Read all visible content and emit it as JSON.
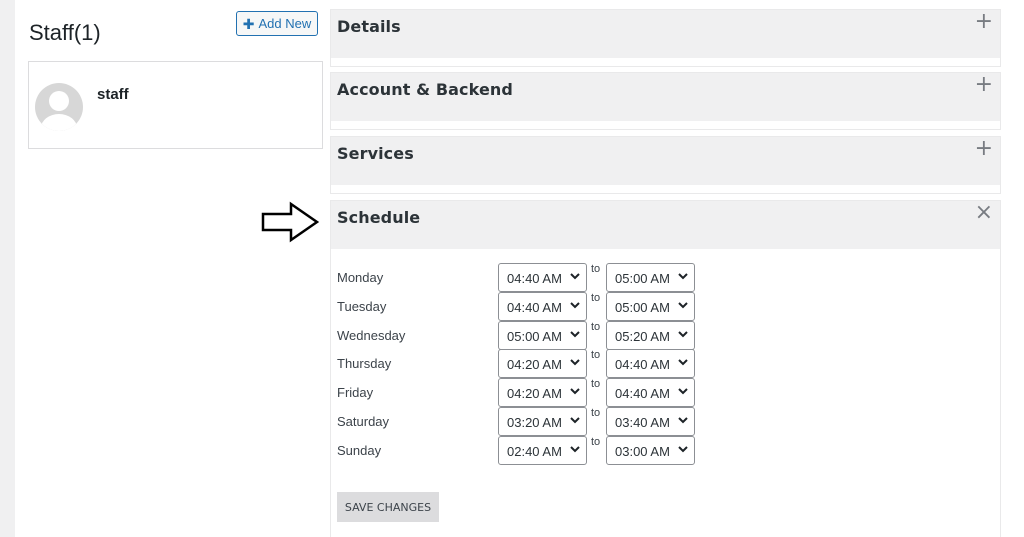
{
  "staff_list": {
    "title": "Staff(1)",
    "add_new_label": "Add New",
    "members": [
      {
        "name": "staff"
      }
    ]
  },
  "panels": {
    "details": {
      "title": "Details",
      "toggle": "+"
    },
    "account": {
      "title": "Account & Backend",
      "toggle": "+"
    },
    "services": {
      "title": "Services",
      "toggle": "+"
    },
    "schedule": {
      "title": "Schedule",
      "toggle": "×"
    }
  },
  "schedule": {
    "to_label": "to",
    "days": [
      {
        "day": "Monday",
        "from": "04:40 AM",
        "to": "05:00 AM"
      },
      {
        "day": "Tuesday",
        "from": "04:40 AM",
        "to": "05:00 AM"
      },
      {
        "day": "Wednesday",
        "from": "05:00 AM",
        "to": "05:20 AM"
      },
      {
        "day": "Thursday",
        "from": "04:20 AM",
        "to": "04:40 AM"
      },
      {
        "day": "Friday",
        "from": "04:20 AM",
        "to": "04:40 AM"
      },
      {
        "day": "Saturday",
        "from": "03:20 AM",
        "to": "03:40 AM"
      },
      {
        "day": "Sunday",
        "from": "02:40 AM",
        "to": "03:00 AM"
      }
    ],
    "save_label": "SAVE CHANGES"
  },
  "colors": {
    "accent": "#2271b1",
    "panel_header_bg": "#f0f0f1",
    "save_button_bg": "#dcdcde"
  }
}
